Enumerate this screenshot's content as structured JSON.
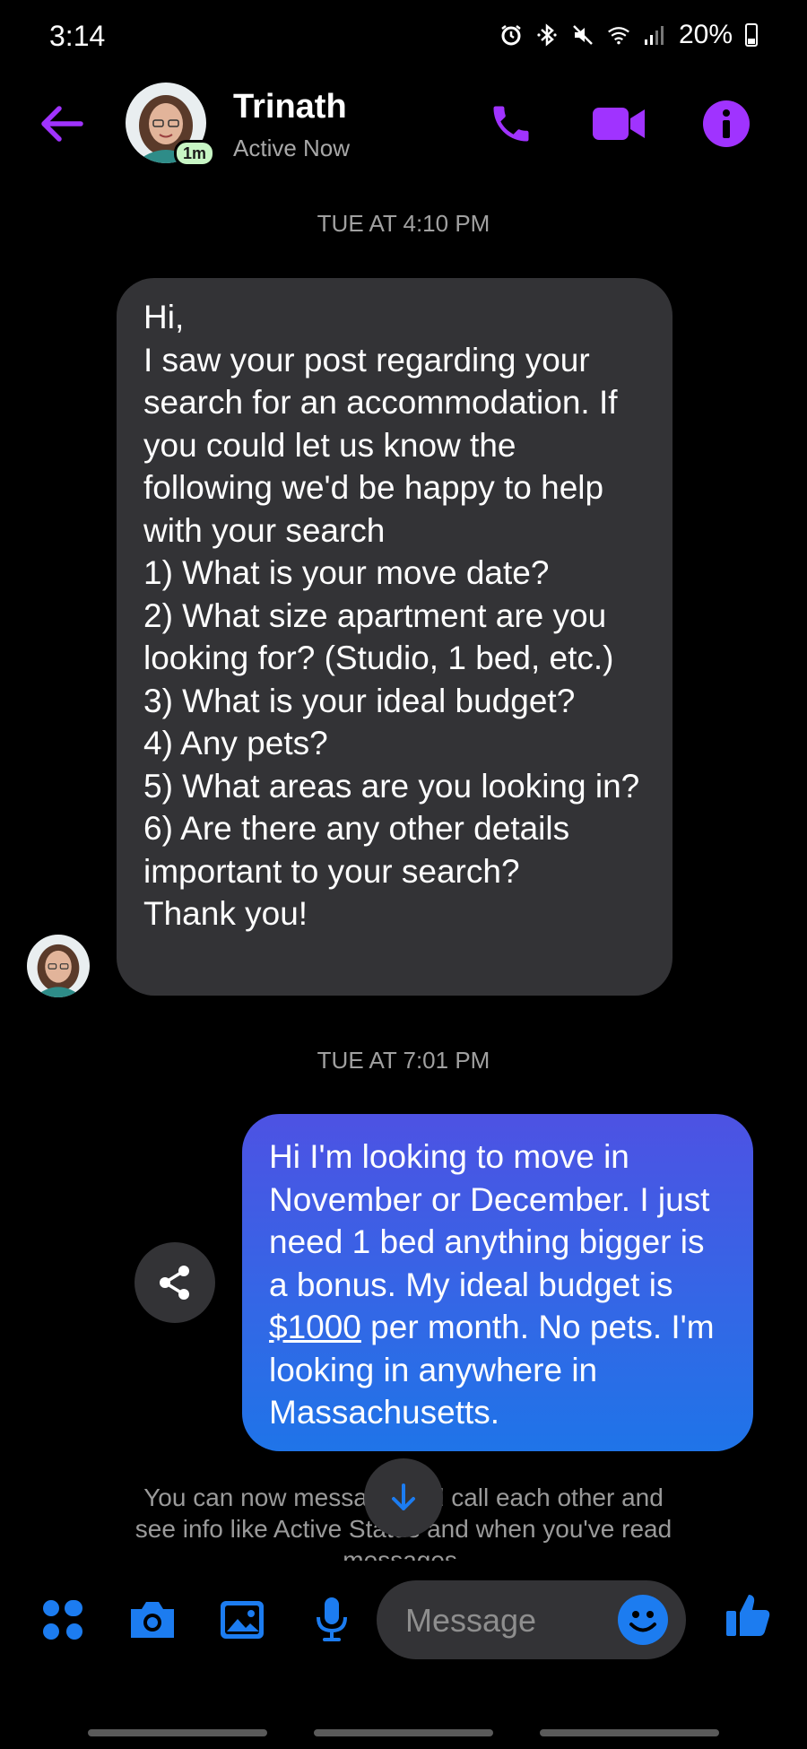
{
  "status_bar": {
    "time": "3:14",
    "battery": "20%",
    "icons": [
      "alarm-icon",
      "bluetooth-icon",
      "mute-icon",
      "wifi-icon",
      "signal-icon",
      "battery-icon"
    ]
  },
  "header": {
    "contact_name": "Trinath",
    "status": "Active Now",
    "active_badge": "1m",
    "accent_color": "#a033ff"
  },
  "conversation": {
    "timestamp_1": "TUE AT 4:10 PM",
    "incoming_message": "Hi,\nI saw your post regarding your search for an accommodation. If you could let us know the following we'd be happy to help with your search\n1) What is your move date?\n2) What size apartment are you looking for? (Studio, 1 bed, etc.)\n3) What is your ideal budget?\n4) Any pets?\n5) What areas are you looking in?\n6) Are there any other details important to your search?\nThank you!",
    "timestamp_2": "TUE AT 7:01 PM",
    "outgoing_before": "Hi I'm looking to move in November or December. I just need 1 bed anything bigger is a bonus. My ideal budget is ",
    "outgoing_link": "$1000",
    "outgoing_after": " per month. No pets. I'm looking in anywhere in Massachusetts.",
    "notice": "You can now message and call each other and see info like Active Status and when you've read messages."
  },
  "composer": {
    "placeholder": "Message",
    "icon_color": "#1c7cf0"
  }
}
